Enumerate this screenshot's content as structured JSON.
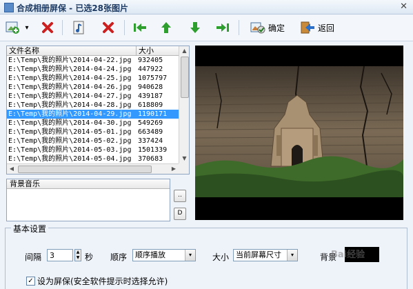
{
  "window": {
    "title": "合成相册屏保 - 已选28张图片",
    "close_glyph": "✕"
  },
  "toolbar": {
    "confirm_label": "确定",
    "back_label": "返回",
    "dropdown_glyph": "▾",
    "icons": [
      "add-image-icon",
      "delete-icon",
      "music-note-icon",
      "delete-music-icon",
      "move-first-icon",
      "move-up-icon",
      "move-down-icon",
      "move-last-icon",
      "confirm-icon",
      "back-icon"
    ]
  },
  "file_list": {
    "headers": {
      "name": "文件名称",
      "size": "大小"
    },
    "rows": [
      {
        "name": "E:\\Temp\\我的照片\\2014-04-22.jpg",
        "size": "932405"
      },
      {
        "name": "E:\\Temp\\我的照片\\2014-04-24.jpg",
        "size": "447922"
      },
      {
        "name": "E:\\Temp\\我的照片\\2014-04-25.jpg",
        "size": "1075797"
      },
      {
        "name": "E:\\Temp\\我的照片\\2014-04-26.jpg",
        "size": "940628"
      },
      {
        "name": "E:\\Temp\\我的照片\\2014-04-27.jpg",
        "size": "439187"
      },
      {
        "name": "E:\\Temp\\我的照片\\2014-04-28.jpg",
        "size": "618809"
      },
      {
        "name": "E:\\Temp\\我的照片\\2014-04-29.jpg",
        "size": "1190171",
        "selected": true
      },
      {
        "name": "E:\\Temp\\我的照片\\2014-04-30.jpg",
        "size": "549269"
      },
      {
        "name": "E:\\Temp\\我的照片\\2014-05-01.jpg",
        "size": "663489"
      },
      {
        "name": "E:\\Temp\\我的照片\\2014-05-02.jpg",
        "size": "337424"
      },
      {
        "name": "E:\\Temp\\我的照片\\2014-05-03.jpg",
        "size": "1501339"
      },
      {
        "name": "E:\\Temp\\我的照片\\2014-05-04.jpg",
        "size": "370683"
      }
    ],
    "scroll_arrows": {
      "up": "▲",
      "down": "▼",
      "left": "◀",
      "right": "▶"
    }
  },
  "music": {
    "header": "背景音乐",
    "browse_label": "..",
    "delete_label": "D"
  },
  "settings": {
    "legend": "基本设置",
    "interval_label": "间隔",
    "interval_value": "3",
    "interval_unit": "秒",
    "order_label": "顺序",
    "order_value": "顺序播放",
    "size_label": "大小",
    "size_value": "当前屏幕尺寸",
    "background_label": "背景",
    "background_color": "#000000",
    "screensaver_checkbox_label": "设为屏保(安全软件提示时选择允许)",
    "screensaver_checked": true,
    "check_glyph": "✓",
    "spin_up": "▲",
    "spin_down": "▼",
    "dropdown_glyph": "▾"
  },
  "preview": {
    "image_subject": "ancient temple ruin in cracked cliff wall"
  },
  "watermark": "Bai经验"
}
